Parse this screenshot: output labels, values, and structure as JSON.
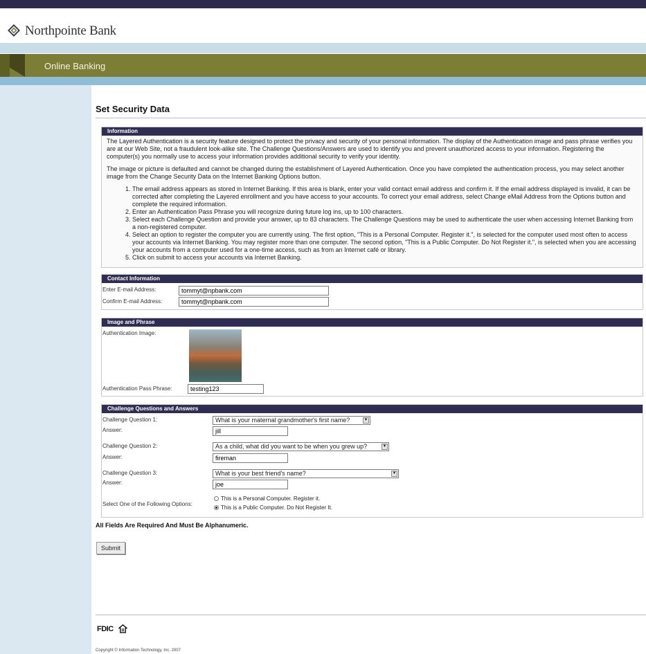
{
  "brand": {
    "name": "Northpointe Bank",
    "logo_icon": "diamond-compass-logo"
  },
  "banner": {
    "title": "Online Banking"
  },
  "page": {
    "title": "Set Security Data"
  },
  "information": {
    "heading": "Information",
    "para1": "The Layered Authentication is a security feature designed to protect the privacy and security of your personal information. The display of the Authentication image and pass phrase verifies you are at our Web Site, not a fraudulent look-alike site. The Challenge Questions/Answers are used to identify you and prevent unauthorized access to your information. Registering the computer(s) you normally use to access your information provides additional security to verify your identity.",
    "para2": "The image or picture is defaulted and cannot be changed during the establishment of Layered Authentication. Once you have completed the authentication process, you may select another image from the Change Security Data on the Internet Banking Options button.",
    "steps": [
      "The email address appears as stored in Internet Banking. If this area is blank, enter your valid contact email address and confirm it. If the email address displayed is invalid, it can be corrected after completing the Layered enrollment and you have access to your accounts. To correct your email address, select Change eMail Address from the Options button and complete the required information.",
      "Enter an Authentication Pass Phrase you will recognize during future log ins, up to 100 characters.",
      "Select each Challenge Question and provide your answer, up to 83 characters. The Challenge Questions may be used to authenticate the user when accessing Internet Banking from a non-registered computer.",
      "Select an option to register the computer you are currently using. The first option, \"This is a Personal Computer. Register it.\", is selected for the computer used most often to access your accounts via Internet Banking. You may register more than one computer. The second option, \"This is a Public Computer. Do Not Register it.\", is selected when you are accessing your accounts from a computer used for a one-time access, such as from an Internet café or library.",
      "Click on submit to access your accounts via Internet Banking."
    ]
  },
  "contact": {
    "heading": "Contact Information",
    "email_label": "Enter E-mail Address:",
    "email_value": "tommyt@npbank.com",
    "confirm_label": "Confirm E-mail Address:",
    "confirm_value": "tommyt@npbank.com"
  },
  "image_phrase": {
    "heading": "Image and Phrase",
    "image_label": "Authentication Image:",
    "phrase_label": "Authentication Pass Phrase:",
    "phrase_value": "testing123"
  },
  "challenge": {
    "heading": "Challenge Questions and Answers",
    "questions": [
      {
        "label": "Challenge Question 1:",
        "selected": "What is your maternal grandmother's first name?",
        "answer_label": "Answer:",
        "answer": "jill"
      },
      {
        "label": "Challenge Question 2:",
        "selected": "As a child, what did you want to be when you grew up?",
        "answer_label": "Answer:",
        "answer": "fireman"
      },
      {
        "label": "Challenge Question 3:",
        "selected": "What is your best friend's name?",
        "answer_label": "Answer:",
        "answer": "joe"
      }
    ],
    "options_label": "Select One of the Following Options:",
    "option_personal": "This is a Personal Computer. Register it.",
    "option_public": "This is a Public Computer. Do Not Register It.",
    "selected_option": "public"
  },
  "required_note": "All Fields Are Required And Must Be Alphanumeric.",
  "submit_label": "Submit",
  "footer": {
    "fdic": "FDIC",
    "equal_housing_icon": "equal-housing-icon",
    "copyright": "Copyright © Information Technology, Inc. 2007"
  }
}
